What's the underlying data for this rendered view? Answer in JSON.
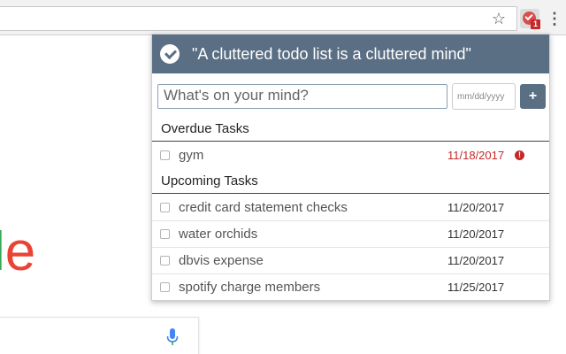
{
  "popup": {
    "header_title": "\"A cluttered todo list is a cluttered mind\"",
    "task_input_placeholder": "What's on your mind?",
    "date_input_placeholder": "mm/dd/yyyy",
    "add_button_label": "+",
    "sections": [
      {
        "title": "Overdue Tasks",
        "tasks": [
          {
            "name": "gym",
            "date": "11/18/2017",
            "overdue": true,
            "checked": false
          }
        ]
      },
      {
        "title": "Upcoming Tasks",
        "tasks": [
          {
            "name": "credit card statement checks",
            "date": "11/20/2017",
            "overdue": false,
            "checked": false
          },
          {
            "name": "water orchids",
            "date": "11/20/2017",
            "overdue": false,
            "checked": false
          },
          {
            "name": "dbvis expense",
            "date": "11/20/2017",
            "overdue": false,
            "checked": false
          },
          {
            "name": "spotify charge members",
            "date": "11/25/2017",
            "overdue": false,
            "checked": false
          }
        ]
      }
    ],
    "alert_icon_glyph": "!"
  },
  "browser": {
    "extension_badge": "1",
    "star_glyph": "☆",
    "menu_glyph": "⋮",
    "google_partial_letters": [
      "l",
      "e"
    ]
  },
  "icons": {
    "header": "check-circle-icon",
    "overdue": "exclamation-circle-icon",
    "bookmark": "star-icon",
    "menu": "kebab-menu-icon",
    "search": "microphone-icon"
  },
  "colors": {
    "header_bg": "#5a6e84",
    "overdue": "#c62828",
    "google_green": "#34a853",
    "google_red": "#ea4335"
  }
}
